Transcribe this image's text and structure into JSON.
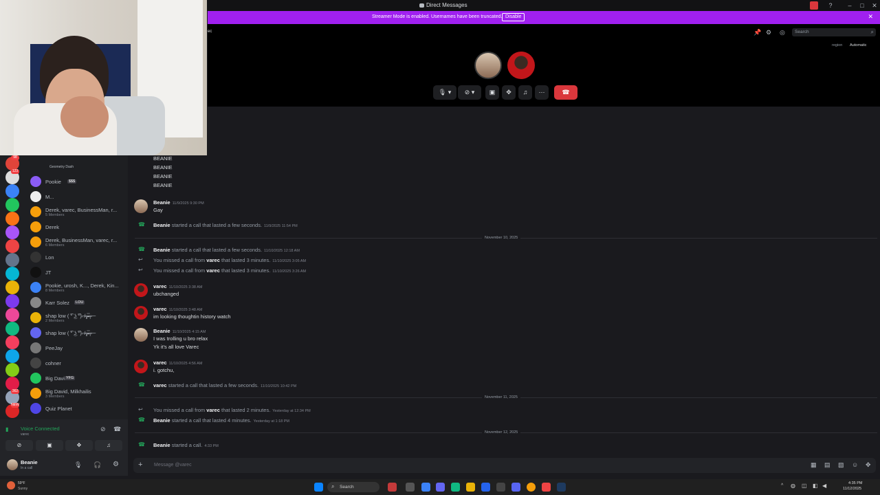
{
  "window": {
    "title": "Direct Messages"
  },
  "banner": {
    "message": "Streamer Mode is enabled. Usernames have been truncated.",
    "button": "Disable"
  },
  "header": {
    "search_placeholder": "Search",
    "region_label": "region",
    "region_value": "Automatic",
    "channel_fragment": "ec"
  },
  "sidebar": {
    "guild_badges": [
      "98",
      "123",
      "",
      "",
      "",
      "",
      "",
      "",
      "",
      "",
      "",
      "",
      "",
      "",
      "",
      "",
      "",
      "362",
      "NEW"
    ],
    "dms": [
      {
        "name": "Geometry Dash",
        "sub": ""
      },
      {
        "name": "Pookie",
        "sub": "",
        "tag": "$$$"
      },
      {
        "name": "M...",
        "sub": ""
      },
      {
        "name": "Derek, varec, BusinessMan, r...",
        "sub": "5 Members"
      },
      {
        "name": "Derek",
        "sub": ""
      },
      {
        "name": "Derek, BusinessMan, varec, r...",
        "sub": "6 Members"
      },
      {
        "name": "Lon",
        "sub": ""
      },
      {
        "name": "JT",
        "sub": ""
      },
      {
        "name": "Pookie, urosh, K..., Derek, Kin...",
        "sub": "8 Members"
      },
      {
        "name": "Karr Solez",
        "sub": "",
        "tag": "LOU"
      },
      {
        "name": "ꜱhap low ( ͡° ͜ʖ ͡°)⌐̸╦̵̵̿╤─",
        "sub": "2 Members"
      },
      {
        "name": "ꜱhap low ( ͡° ͜ʖ ͡°)⌐̸╦̵̵̿╤─",
        "sub": ""
      },
      {
        "name": "PeeJay",
        "sub": ""
      },
      {
        "name": "cohner",
        "sub": ""
      },
      {
        "name": "Big David",
        "sub": "",
        "tag": "YFG"
      },
      {
        "name": "Big David, Milkhailis",
        "sub": "3 Members"
      },
      {
        "name": "Quiz Planet",
        "sub": ""
      }
    ],
    "voice": {
      "status": "Voice Connected",
      "channel": "varec"
    },
    "user": {
      "name": "Beanie",
      "status": "In a call"
    }
  },
  "chat": {
    "top_lines": [
      "BEANIE",
      "BEANIE",
      "BEANIE",
      "BEANIE"
    ],
    "messages": [
      {
        "author": "Beanie",
        "time": "11/9/2025 9:30 PM",
        "lines": [
          "Gay"
        ]
      },
      {
        "sys": "started a call that lasted a few seconds.",
        "who": "Beanie",
        "time": "11/9/2025 11:54 PM"
      },
      {
        "divider": "November 10, 2025"
      },
      {
        "sys": "started a call that lasted a few seconds.",
        "who": "Beanie",
        "time": "11/10/2025 12:18 AM"
      },
      {
        "missed": "You missed a call from",
        "who": "varec",
        "rest": "that lasted 3 minutes.",
        "time": "11/10/2025 3:05 AM"
      },
      {
        "missed": "You missed a call from",
        "who": "varec",
        "rest": "that lasted 3 minutes.",
        "time": "11/10/2025 3:26 AM"
      },
      {
        "author": "varec",
        "time": "11/10/2025 3:38 AM",
        "lines": [
          "ubchanged"
        ]
      },
      {
        "author": "varec",
        "time": "11/10/2025 3:48 AM",
        "lines": [
          "im looking thoughtin history watch"
        ]
      },
      {
        "author": "Beanie",
        "time": "11/10/2025 4:15 AM",
        "lines": [
          "I was trolling u bro relax",
          "Yk it's all love Varec"
        ]
      },
      {
        "author": "varec",
        "time": "11/10/2025 4:56 AM",
        "lines": [
          "i. gotchu,"
        ]
      },
      {
        "sys": "started a call that lasted a few seconds.",
        "who": "varec",
        "time": "11/10/2025 10:42 PM"
      },
      {
        "divider": "November 11, 2025"
      },
      {
        "missed": "You missed a call from",
        "who": "varec",
        "rest": "that lasted 2 minutes.",
        "time": "Yesterday at 12:34 PM"
      },
      {
        "sys": "started a call that lasted 4 minutes.",
        "who": "Beanie",
        "time": "Yesterday at 1:18 PM"
      },
      {
        "divider": "November 12, 2025"
      },
      {
        "sys": "started a call.",
        "who": "Beanie",
        "time": "4:33 PM"
      }
    ],
    "composer_placeholder": "Message @varec"
  },
  "taskbar": {
    "search": "Search",
    "time": "4:35 PM",
    "date": "11/12/2025",
    "weather": "59°F",
    "weather_sub": "Sunny"
  },
  "colors": {
    "accent": "#a020f0",
    "hangup": "#da373c",
    "call_green": "#23a55a"
  }
}
